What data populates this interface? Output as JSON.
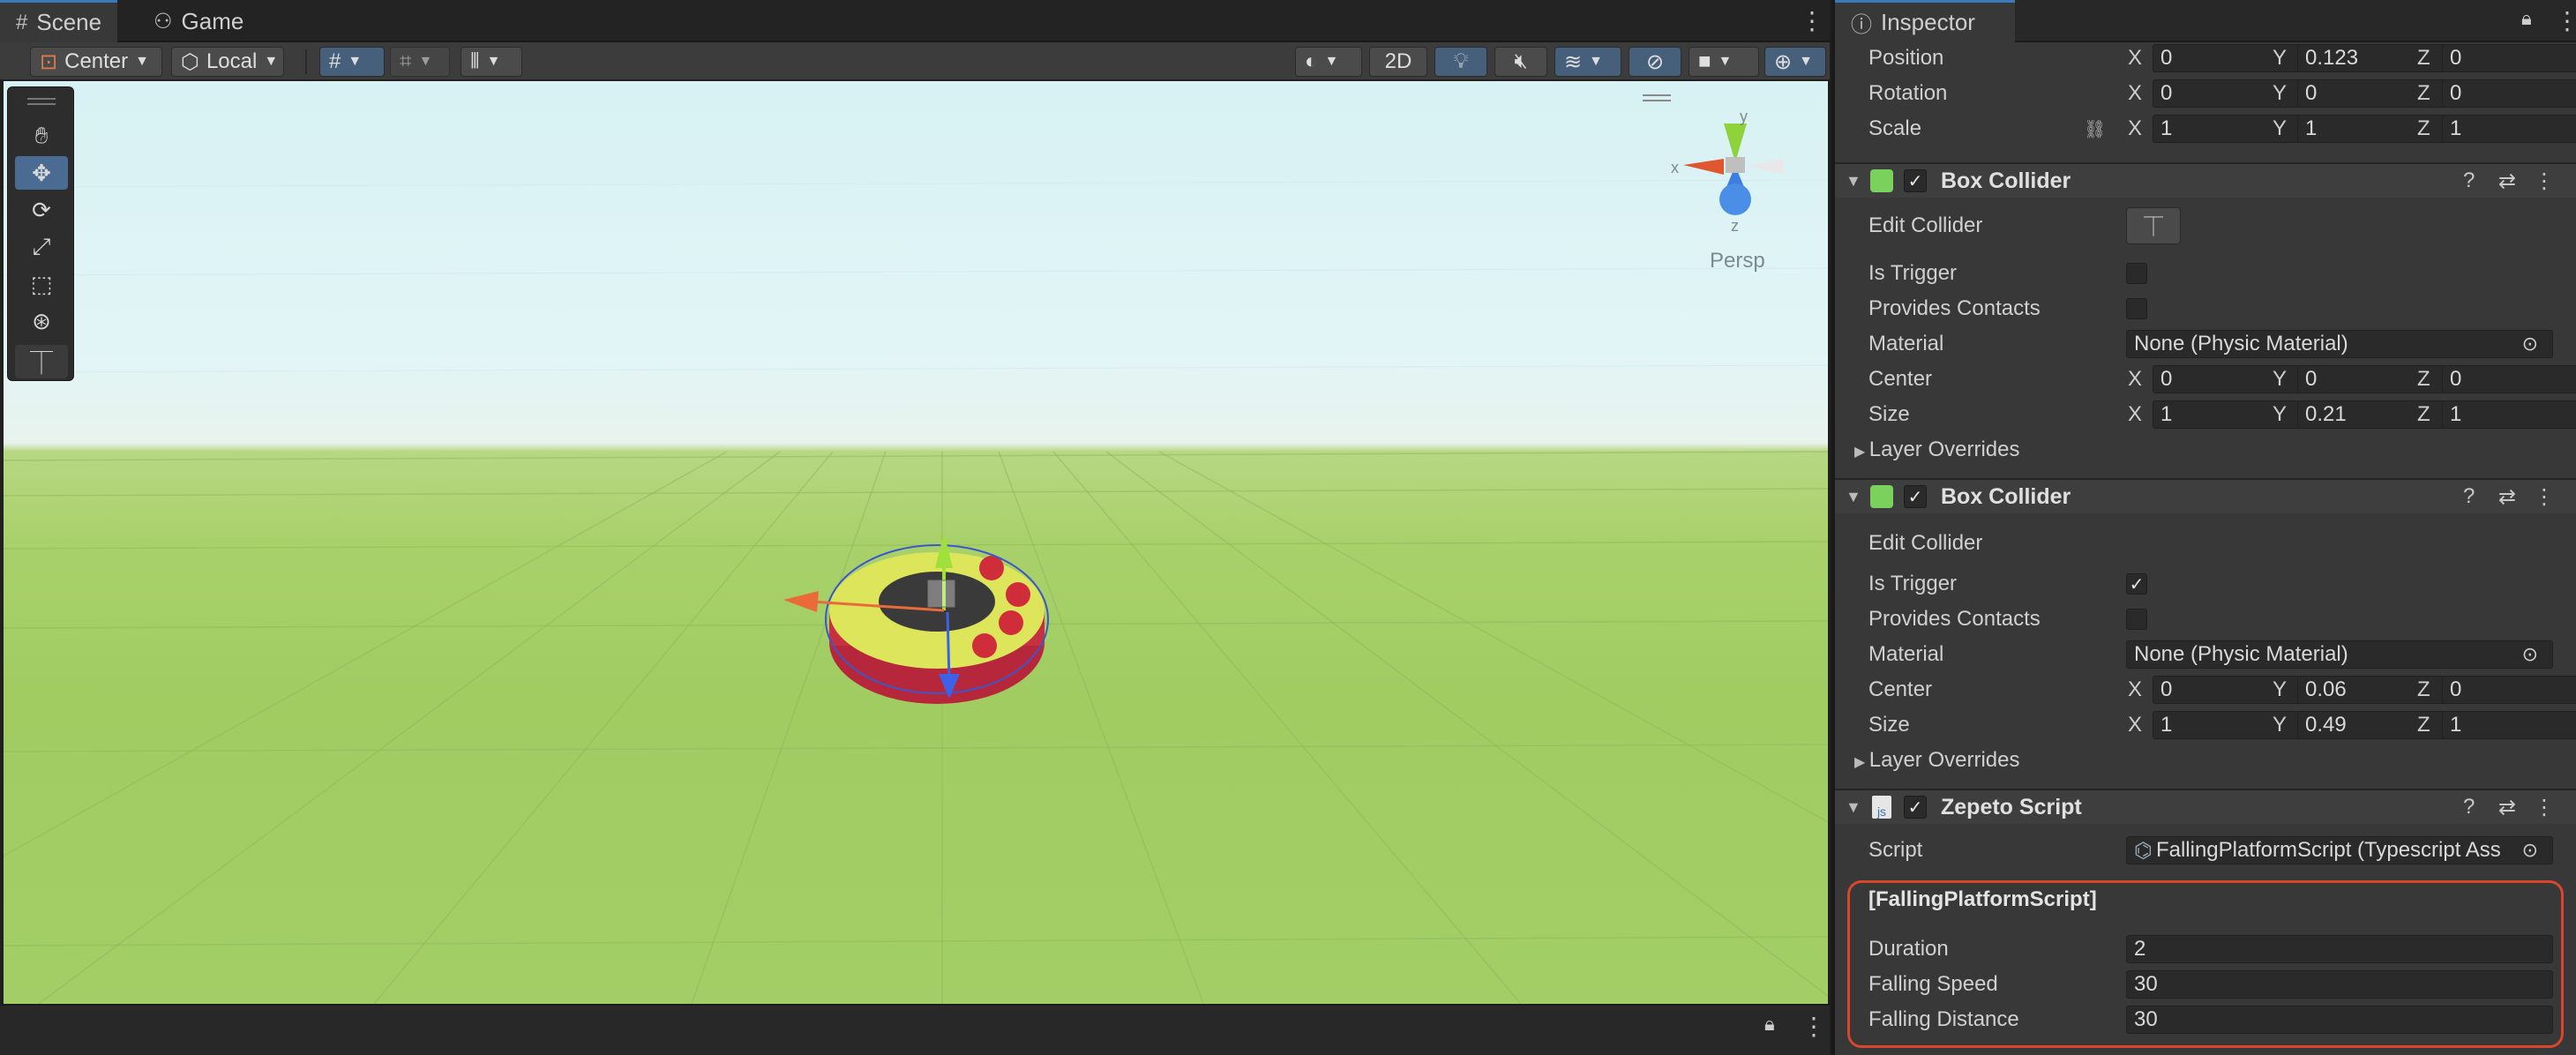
{
  "scene": {
    "tabs": [
      {
        "label": "Scene",
        "icon": "hash-icon"
      },
      {
        "label": "Game",
        "icon": "gamepad-icon"
      }
    ],
    "toolbar": {
      "pivot": "Center",
      "space": "Local",
      "mode_2d": "2D"
    },
    "gizmo": {
      "projection": "Persp",
      "axis_x": "x",
      "axis_y": "y",
      "axis_z": "z"
    }
  },
  "inspector": {
    "tab_label": "Inspector",
    "transform": {
      "position": {
        "label": "Position",
        "x": "0",
        "y": "0.123",
        "z": "0"
      },
      "rotation": {
        "label": "Rotation",
        "x": "0",
        "y": "0",
        "z": "0"
      },
      "scale": {
        "label": "Scale",
        "x": "1",
        "y": "1",
        "z": "1"
      }
    },
    "axis_labels": {
      "x": "X",
      "y": "Y",
      "z": "Z"
    },
    "box_collider_1": {
      "title": "Box Collider",
      "edit_collider": "Edit Collider",
      "is_trigger": "Is Trigger",
      "is_trigger_checked": false,
      "provides_contacts": "Provides Contacts",
      "provides_contacts_checked": false,
      "material_label": "Material",
      "material_value": "None (Physic Material)",
      "center": {
        "label": "Center",
        "x": "0",
        "y": "0",
        "z": "0"
      },
      "size": {
        "label": "Size",
        "x": "1",
        "y": "0.21",
        "z": "1"
      },
      "layer_overrides": "Layer Overrides"
    },
    "box_collider_2": {
      "title": "Box Collider",
      "edit_collider": "Edit Collider",
      "is_trigger": "Is Trigger",
      "is_trigger_checked": true,
      "provides_contacts": "Provides Contacts",
      "provides_contacts_checked": false,
      "material_label": "Material",
      "material_value": "None (Physic Material)",
      "center": {
        "label": "Center",
        "x": "0",
        "y": "0.06",
        "z": "0"
      },
      "size": {
        "label": "Size",
        "x": "1",
        "y": "0.49",
        "z": "1"
      },
      "layer_overrides": "Layer Overrides"
    },
    "zepeto_script": {
      "title": "Zepeto Script",
      "script_label": "Script",
      "script_value": "FallingPlatformScript (Typescript Ass",
      "section_title": "[FallingPlatformScript]",
      "duration": {
        "label": "Duration",
        "value": "2"
      },
      "falling_speed": {
        "label": "Falling Speed",
        "value": "30"
      },
      "falling_distance": {
        "label": "Falling Distance",
        "value": "30"
      }
    }
  },
  "colors": {
    "accent_blue": "#3a79bb",
    "highlight_red": "#d9472b",
    "collider_green": "#7ad15b"
  }
}
